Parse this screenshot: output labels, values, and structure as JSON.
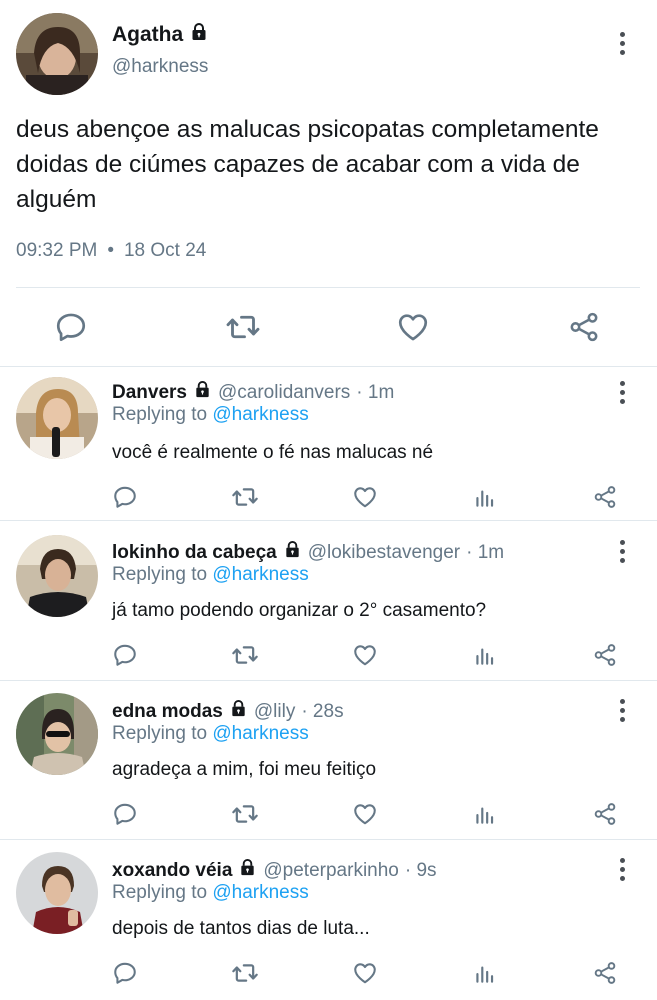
{
  "main_tweet": {
    "display_name": "Agatha",
    "handle": "@harkness",
    "text": "deus abençoe as malucas psicopatas completamente doidas de ciúmes capazes de acabar com a vida de alguém",
    "time": "09:32 PM",
    "separator": "•",
    "date": "18 Oct 24",
    "actions": [
      "reply-icon",
      "retweet-icon",
      "like-icon",
      "share-icon"
    ]
  },
  "replies": [
    {
      "display_name": "Danvers",
      "handle": "@carolidanvers",
      "age": "· 1m",
      "replying_prefix": "Replying to",
      "replying_to": "@harkness",
      "text": "você é realmente o fé nas malucas né"
    },
    {
      "display_name": "lokinho da cabeça",
      "handle": "@lokibestavenger",
      "age": "· 1m",
      "replying_prefix": "Replying to",
      "replying_to": "@harkness",
      "text": "já tamo podendo organizar o 2° casamento?"
    },
    {
      "display_name": "edna modas",
      "handle": "@lily",
      "age": "· 28s",
      "replying_prefix": "Replying to",
      "replying_to": "@harkness",
      "text": "agradeça a mim, foi meu feitiço"
    },
    {
      "display_name": "xoxando véia",
      "handle": "@peterparkinho",
      "age": "· 9s",
      "replying_prefix": "Replying to",
      "replying_to": "@harkness",
      "text": "depois de tantos dias de luta..."
    }
  ],
  "colors": {
    "accent_link": "#1da1f2",
    "secondary_text": "#657786",
    "icon_gray": "#657786",
    "divider": "#e1e8ed"
  }
}
